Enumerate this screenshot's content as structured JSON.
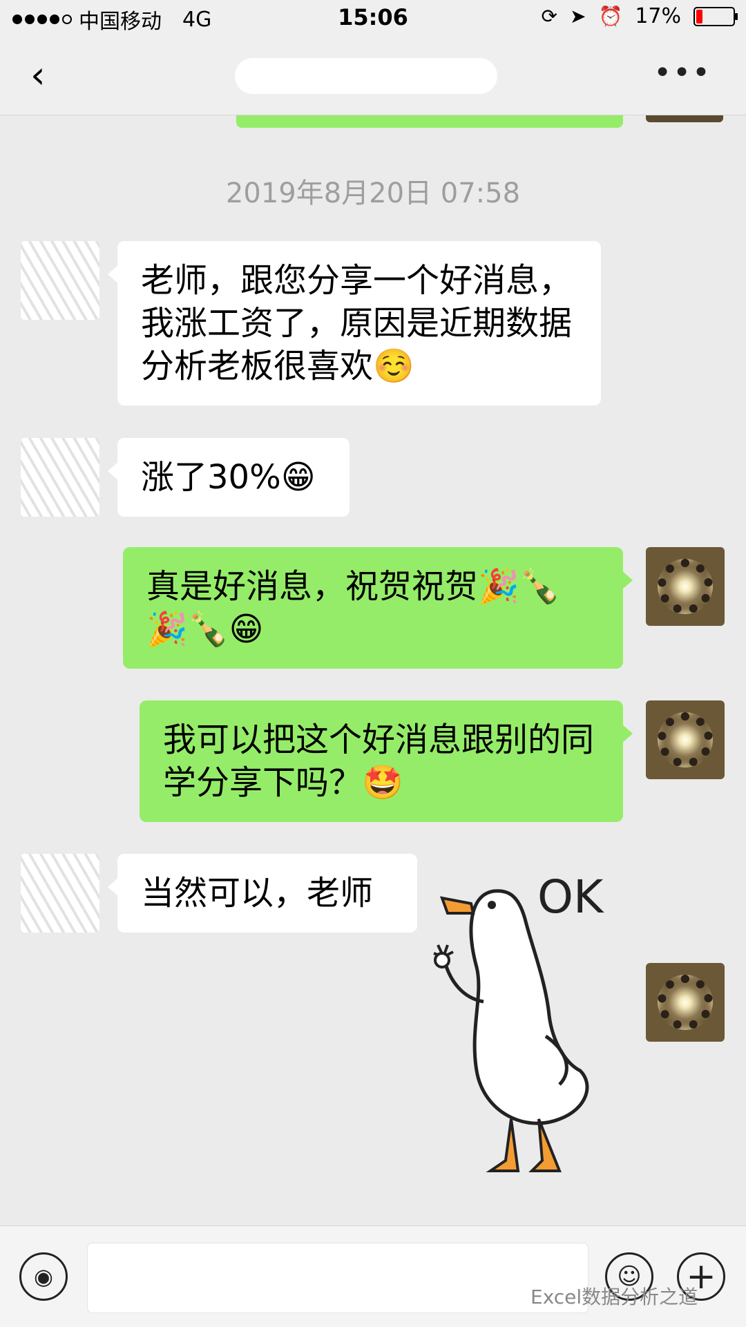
{
  "status_bar": {
    "carrier": "中国移动",
    "network": "4G",
    "time": "15:06",
    "battery": "17%",
    "battery_level": 0.17
  },
  "nav": {
    "back_icon": "chevron-left-icon",
    "more_icon": "more-dots-icon"
  },
  "messages": [
    {
      "side": "left",
      "text": "老师，跟您分享一个好消息，我涨工资了，原因是近期数据分析老板很喜欢☺️"
    },
    {
      "side": "left",
      "text": "涨了30%😁"
    },
    {
      "side": "right",
      "text": "真是好消息，祝贺祝贺🎉🍾🎉🍾😁"
    },
    {
      "side": "right",
      "text": "我可以把这个好消息跟别的同学分享下吗？🤩"
    },
    {
      "side": "left",
      "text": "当然可以，老师"
    },
    {
      "side": "right",
      "type": "sticker",
      "text": "OK"
    }
  ],
  "timestamp": "2019年8月20日 07:58",
  "input_bar": {
    "voice_icon": "voice-icon",
    "emoji_icon": "emoji-icon",
    "plus_icon": "plus-icon"
  },
  "watermark": "Excel数据分析之道",
  "colors": {
    "background": "#ebebeb",
    "sent_bubble": "#95ec69",
    "received_bubble": "#ffffff",
    "timestamp": "#9e9e9e"
  }
}
